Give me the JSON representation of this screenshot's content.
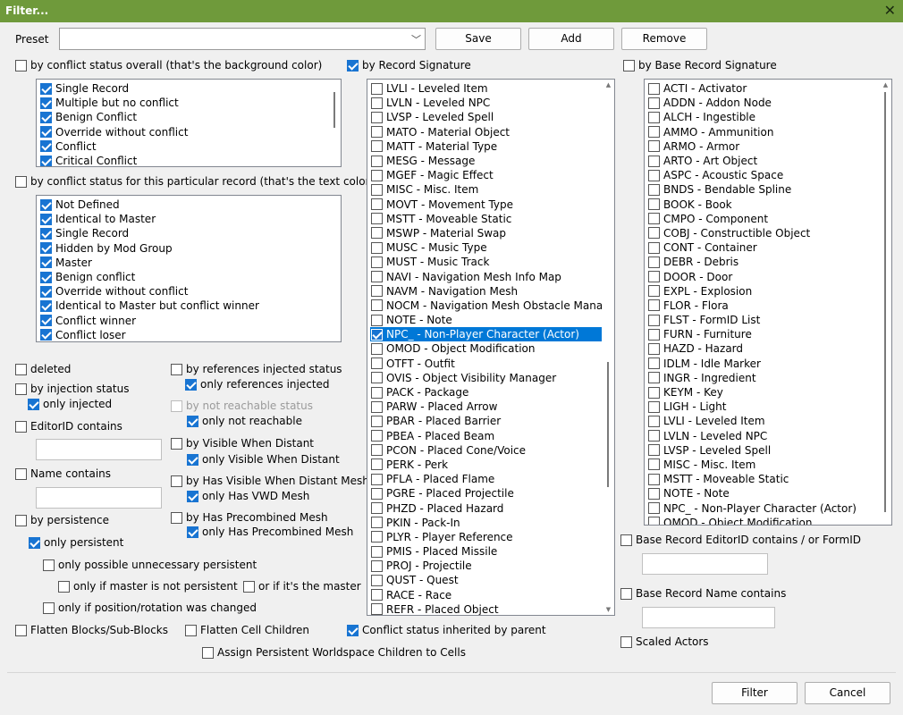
{
  "window": {
    "title": "Filter...",
    "close_glyph": "✕"
  },
  "preset": {
    "label": "Preset",
    "value": "",
    "save": "Save",
    "add": "Add",
    "remove": "Remove"
  },
  "conflict_overall": {
    "label": "by conflict status overall (that's the background color)",
    "checked": false,
    "items": [
      {
        "label": "Single Record",
        "checked": true
      },
      {
        "label": "Multiple but no conflict",
        "checked": true
      },
      {
        "label": "Benign Conflict",
        "checked": true
      },
      {
        "label": "Override without conflict",
        "checked": true
      },
      {
        "label": "Conflict",
        "checked": true
      },
      {
        "label": "Critical Conflict",
        "checked": true
      }
    ]
  },
  "conflict_record": {
    "label": "by conflict status for this particular record  (that's the text color)",
    "checked": false,
    "items": [
      {
        "label": "Not Defined",
        "checked": true
      },
      {
        "label": "Identical to Master",
        "checked": true
      },
      {
        "label": "Single Record",
        "checked": true
      },
      {
        "label": "Hidden by Mod Group",
        "checked": true
      },
      {
        "label": "Master",
        "checked": true
      },
      {
        "label": "Benign conflict",
        "checked": true
      },
      {
        "label": "Override without conflict",
        "checked": true
      },
      {
        "label": "Identical to Master but conflict winner",
        "checked": true
      },
      {
        "label": "Conflict winner",
        "checked": true
      },
      {
        "label": "Conflict loser",
        "checked": true
      }
    ]
  },
  "opts": {
    "deleted": {
      "label": "deleted",
      "checked": false
    },
    "injection": {
      "label": "by injection status",
      "checked": false
    },
    "only_injected": {
      "label": "only injected",
      "checked": true
    },
    "editorid": {
      "label": "EditorID contains",
      "checked": false,
      "value": ""
    },
    "name": {
      "label": "Name contains",
      "checked": false,
      "value": ""
    },
    "persistence": {
      "label": "by persistence",
      "checked": false
    },
    "only_persistent": {
      "label": "only persistent",
      "checked": true
    },
    "only_possible_unnecessary": {
      "label": "only possible unnecessary persistent",
      "checked": false
    },
    "only_if_master_not": {
      "label": "only if master is not persistent",
      "checked": false
    },
    "or_if_master": {
      "label": "or if it's the master",
      "checked": false
    },
    "only_if_pos_changed": {
      "label": "only if position/rotation was changed",
      "checked": false
    },
    "refs_injected": {
      "label": "by references injected status",
      "checked": false
    },
    "only_refs_injected": {
      "label": "only references injected",
      "checked": true
    },
    "not_reachable": {
      "label": "by not reachable status",
      "checked": false
    },
    "only_not_reachable": {
      "label": "only not reachable",
      "checked": true
    },
    "visible_distant": {
      "label": "by Visible When Distant",
      "checked": false
    },
    "only_visible_distant": {
      "label": "only Visible When Distant",
      "checked": true
    },
    "vwd_mesh": {
      "label": "by Has Visible When Distant Mesh",
      "checked": false
    },
    "only_vwd_mesh": {
      "label": "only Has VWD Mesh",
      "checked": true
    },
    "precombined": {
      "label": "by Has Precombined Mesh",
      "checked": false
    },
    "only_precombined": {
      "label": "only Has Precombined Mesh",
      "checked": true
    },
    "flatten_blocks": {
      "label": "Flatten Blocks/Sub-Blocks",
      "checked": false
    },
    "flatten_cell": {
      "label": "Flatten Cell Children",
      "checked": false
    },
    "conflict_inherited": {
      "label": "Conflict status inherited by parent",
      "checked": true
    },
    "assign_persistent": {
      "label": "Assign Persistent Worldspace Children to Cells",
      "checked": false
    }
  },
  "record_sig": {
    "label": "by Record Signature",
    "checked": true,
    "items": [
      {
        "label": "LVLI - Leveled Item",
        "checked": false
      },
      {
        "label": "LVLN - Leveled NPC",
        "checked": false
      },
      {
        "label": "LVSP - Leveled Spell",
        "checked": false
      },
      {
        "label": "MATO - Material Object",
        "checked": false
      },
      {
        "label": "MATT - Material Type",
        "checked": false
      },
      {
        "label": "MESG - Message",
        "checked": false
      },
      {
        "label": "MGEF - Magic Effect",
        "checked": false
      },
      {
        "label": "MISC - Misc. Item",
        "checked": false
      },
      {
        "label": "MOVT - Movement Type",
        "checked": false
      },
      {
        "label": "MSTT - Moveable Static",
        "checked": false
      },
      {
        "label": "MSWP - Material Swap",
        "checked": false
      },
      {
        "label": "MUSC - Music Type",
        "checked": false
      },
      {
        "label": "MUST - Music Track",
        "checked": false
      },
      {
        "label": "NAVI - Navigation Mesh Info Map",
        "checked": false
      },
      {
        "label": "NAVM - Navigation Mesh",
        "checked": false
      },
      {
        "label": "NOCM - Navigation Mesh Obstacle Manag",
        "checked": false
      },
      {
        "label": "NOTE - Note",
        "checked": false
      },
      {
        "label": "NPC_ - Non-Player Character (Actor)",
        "checked": true,
        "selected": true
      },
      {
        "label": "OMOD - Object Modification",
        "checked": false
      },
      {
        "label": "OTFT - Outfit",
        "checked": false
      },
      {
        "label": "OVIS - Object Visibility Manager",
        "checked": false
      },
      {
        "label": "PACK - Package",
        "checked": false
      },
      {
        "label": "PARW - Placed Arrow",
        "checked": false
      },
      {
        "label": "PBAR - Placed Barrier",
        "checked": false
      },
      {
        "label": "PBEA - Placed Beam",
        "checked": false
      },
      {
        "label": "PCON - Placed Cone/Voice",
        "checked": false
      },
      {
        "label": "PERK - Perk",
        "checked": false
      },
      {
        "label": "PFLA - Placed Flame",
        "checked": false
      },
      {
        "label": "PGRE - Placed Projectile",
        "checked": false
      },
      {
        "label": "PHZD - Placed Hazard",
        "checked": false
      },
      {
        "label": "PKIN - Pack-In",
        "checked": false
      },
      {
        "label": "PLYR - Player Reference",
        "checked": false
      },
      {
        "label": "PMIS - Placed Missile",
        "checked": false
      },
      {
        "label": "PROJ - Projectile",
        "checked": false
      },
      {
        "label": "QUST - Quest",
        "checked": false
      },
      {
        "label": "RACE - Race",
        "checked": false
      },
      {
        "label": "REFR - Placed Object",
        "checked": false
      }
    ]
  },
  "base_sig": {
    "label": "by Base Record Signature",
    "checked": false,
    "items": [
      {
        "label": "ACTI - Activator",
        "checked": false
      },
      {
        "label": "ADDN - Addon Node",
        "checked": false
      },
      {
        "label": "ALCH - Ingestible",
        "checked": false
      },
      {
        "label": "AMMO - Ammunition",
        "checked": false
      },
      {
        "label": "ARMO - Armor",
        "checked": false
      },
      {
        "label": "ARTO - Art Object",
        "checked": false
      },
      {
        "label": "ASPC - Acoustic Space",
        "checked": false
      },
      {
        "label": "BNDS - Bendable Spline",
        "checked": false
      },
      {
        "label": "BOOK - Book",
        "checked": false
      },
      {
        "label": "CMPO - Component",
        "checked": false
      },
      {
        "label": "COBJ - Constructible Object",
        "checked": false
      },
      {
        "label": "CONT - Container",
        "checked": false
      },
      {
        "label": "DEBR - Debris",
        "checked": false
      },
      {
        "label": "DOOR - Door",
        "checked": false
      },
      {
        "label": "EXPL - Explosion",
        "checked": false
      },
      {
        "label": "FLOR - Flora",
        "checked": false
      },
      {
        "label": "FLST - FormID List",
        "checked": false
      },
      {
        "label": "FURN - Furniture",
        "checked": false
      },
      {
        "label": "HAZD - Hazard",
        "checked": false
      },
      {
        "label": "IDLM - Idle Marker",
        "checked": false
      },
      {
        "label": "INGR - Ingredient",
        "checked": false
      },
      {
        "label": "KEYM - Key",
        "checked": false
      },
      {
        "label": "LIGH - Light",
        "checked": false
      },
      {
        "label": "LVLI - Leveled Item",
        "checked": false
      },
      {
        "label": "LVLN - Leveled NPC",
        "checked": false
      },
      {
        "label": "LVSP - Leveled Spell",
        "checked": false
      },
      {
        "label": "MISC - Misc. Item",
        "checked": false
      },
      {
        "label": "MSTT - Moveable Static",
        "checked": false
      },
      {
        "label": "NOTE - Note",
        "checked": false
      },
      {
        "label": "NPC_ - Non-Player Character (Actor)",
        "checked": false
      },
      {
        "label": "OMOD - Object Modification",
        "checked": false
      }
    ]
  },
  "base_opts": {
    "editorid": {
      "label": "Base Record EditorID contains / or FormID",
      "checked": false,
      "value": ""
    },
    "name": {
      "label": "Base Record Name contains",
      "checked": false,
      "value": ""
    },
    "scaled": {
      "label": "Scaled Actors",
      "checked": false
    }
  },
  "footer": {
    "filter": "Filter",
    "cancel": "Cancel"
  },
  "colors": {
    "title_bar": "#6f9a3b",
    "checked": "#1874d2",
    "selection": "#0078d7"
  }
}
